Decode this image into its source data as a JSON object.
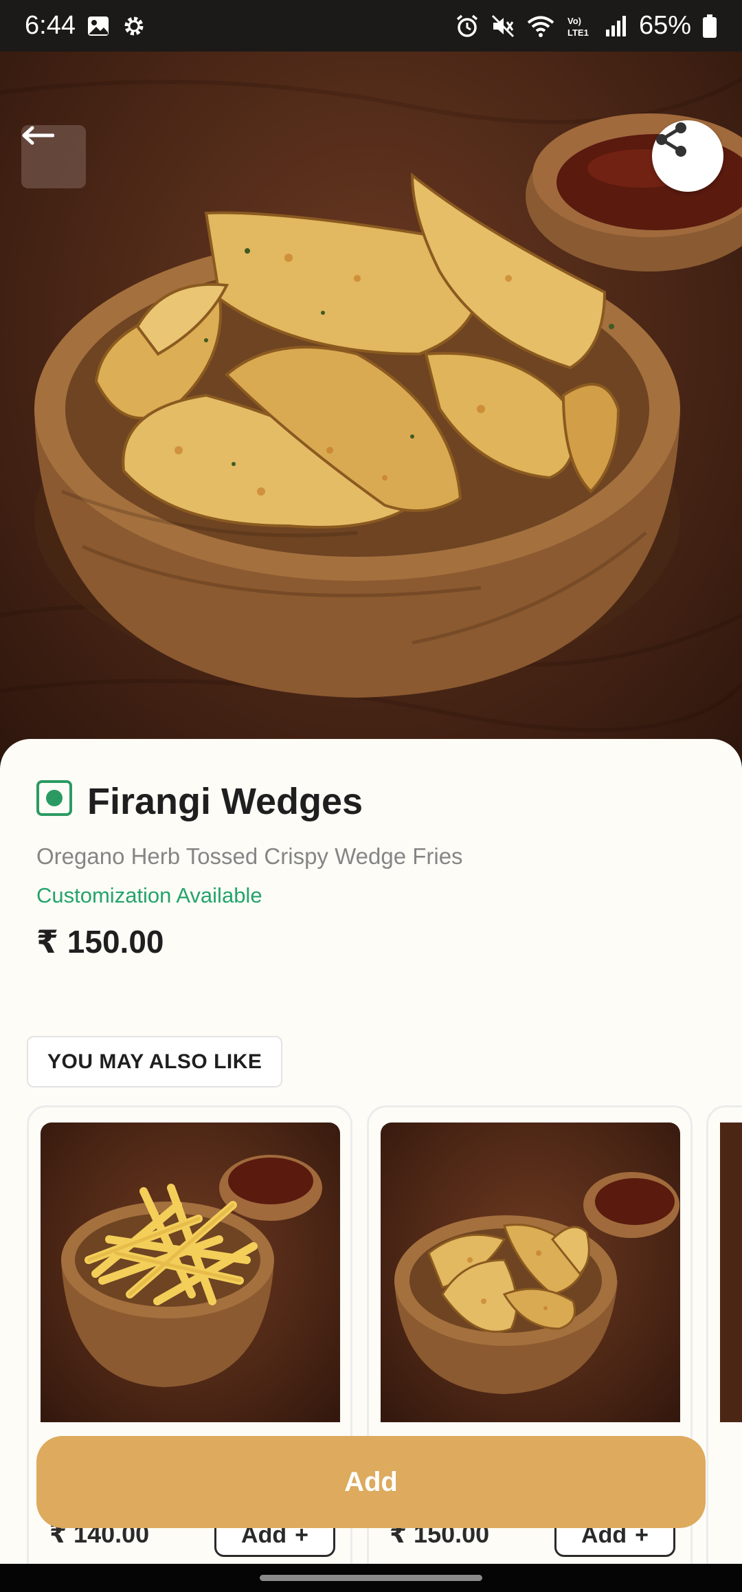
{
  "status_bar": {
    "time": "6:44",
    "battery_percent": "65%",
    "left_icons": [
      "gallery-icon",
      "settings-gear-icon"
    ],
    "right_icons": [
      "alarm-icon",
      "mute-icon",
      "wifi-icon",
      "volte-icon",
      "signal-icon",
      "battery-icon"
    ],
    "network_label": "Vo) LTE1"
  },
  "hero": {
    "back_icon": "arrow-left-icon",
    "share_icon": "share-icon"
  },
  "item": {
    "veg_indicator": "veg-icon",
    "title": "Firangi Wedges",
    "description": "Oregano Herb Tossed Crispy Wedge Fries",
    "customization": "Customization Available",
    "price": "₹ 150.00"
  },
  "recommendations": {
    "heading": "YOU MAY ALSO LIKE",
    "items": [
      {
        "image": "crinkle-fries-bowl",
        "price": "₹ 140.00",
        "add_label": "Add"
      },
      {
        "image": "wedges-bowl",
        "price": "₹ 150.00",
        "add_label": "Add"
      }
    ]
  },
  "footer": {
    "add_label": "Add"
  },
  "colors": {
    "accent_green": "#24a36b",
    "add_button": "#ddaa5e",
    "sheet_background": "#fdfcf7"
  }
}
